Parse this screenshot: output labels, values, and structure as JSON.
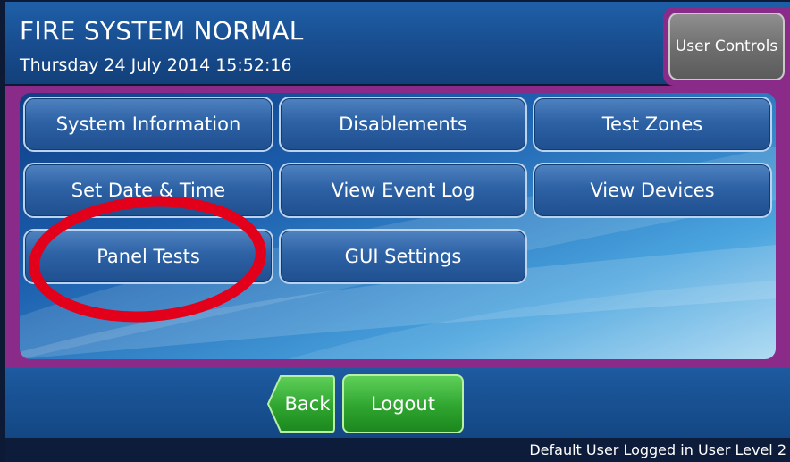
{
  "header": {
    "status_title": "FIRE SYSTEM NORMAL",
    "datetime": "Thursday 24 July 2014 15:52:16",
    "user_controls_label": "User Controls"
  },
  "menu": {
    "items": [
      {
        "label": "System Information"
      },
      {
        "label": "Disablements"
      },
      {
        "label": "Test Zones"
      },
      {
        "label": "Set Date & Time"
      },
      {
        "label": "View Event Log"
      },
      {
        "label": "View Devices"
      },
      {
        "label": "Panel Tests"
      },
      {
        "label": "GUI Settings"
      }
    ]
  },
  "nav": {
    "back_label": "Back",
    "logout_label": "Logout"
  },
  "footer": {
    "status": "Default User Logged in User Level 2"
  },
  "annotation": {
    "color": "#e3001b",
    "highlighted_item": "Panel Tests"
  },
  "colors": {
    "frame": "#8a2b8a",
    "header": "#1f5fa8",
    "menu_button": "#2d62a5",
    "logout": "#2fa52f",
    "user_controls": "#6d6d6d"
  }
}
